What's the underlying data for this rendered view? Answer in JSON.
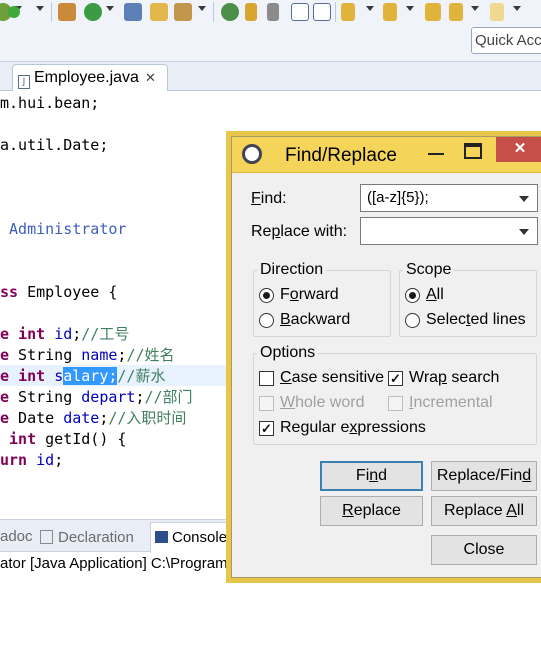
{
  "toolbar": {
    "quick_access_placeholder": "Quick Access",
    "icons": [
      "debug-icon",
      "run-icon",
      "new-java-class-icon",
      "new-server-icon",
      "new-wizard-icon",
      "open-folder-icon",
      "open-type-icon",
      "search-icon",
      "pin-icon",
      "pencil-icon",
      "task-icon",
      "outline-icon",
      "paragraph-icon",
      "next-annotation-icon",
      "prev-annotation-icon",
      "last-edit-icon",
      "back-icon",
      "forward-icon"
    ]
  },
  "editor": {
    "tab_label": "Employee.java",
    "lines": [
      {
        "t": "m.hui.bean;"
      },
      {
        "t": ""
      },
      {
        "t": "a.util.Date;"
      },
      {
        "t": ""
      },
      {
        "t": ""
      },
      {
        "t": ""
      },
      {
        "t": " Administrator"
      },
      {
        "t": ""
      },
      {
        "t": ""
      },
      {
        "t": "ss Employee {"
      },
      {
        "t": ""
      },
      {
        "t": "e int id;//工号"
      },
      {
        "t": "e String name;//姓名"
      },
      {
        "t": "e int salary;//薪水"
      },
      {
        "t": "e String depart;//部门"
      },
      {
        "t": "e Date date;//入职时间"
      },
      {
        "t": " int getId() {"
      },
      {
        "t": "urn id;"
      }
    ]
  },
  "bottom": {
    "tabs": [
      "adoc",
      "Declaration",
      "Console"
    ],
    "console_text": "ator [Java Application] C:\\Program Files"
  },
  "dialog": {
    "title": "Find/Replace",
    "find_label": "Find:",
    "find_value": "([a-z]{5});",
    "replace_label": "Replace with:",
    "replace_value": "",
    "direction": {
      "title": "Direction",
      "forward": "Forward",
      "backward": "Backward",
      "selected": "Forward"
    },
    "scope": {
      "title": "Scope",
      "all": "All",
      "selected_lines": "Selected lines",
      "selected": "All"
    },
    "options": {
      "title": "Options",
      "case_sensitive": "Case sensitive",
      "wrap_search": "Wrap search",
      "whole_word": "Whole word",
      "incremental": "Incremental",
      "regular_expressions": "Regular expressions",
      "states": {
        "case_sensitive": false,
        "wrap_search": true,
        "whole_word": false,
        "incremental": false,
        "regular_expressions": true
      }
    },
    "buttons": {
      "find": "Find",
      "replace_find": "Replace/Find",
      "replace": "Replace",
      "replace_all": "Replace All",
      "close": "Close"
    },
    "title_bar_color": "#f5d559",
    "close_button_color": "#c74f4a"
  }
}
